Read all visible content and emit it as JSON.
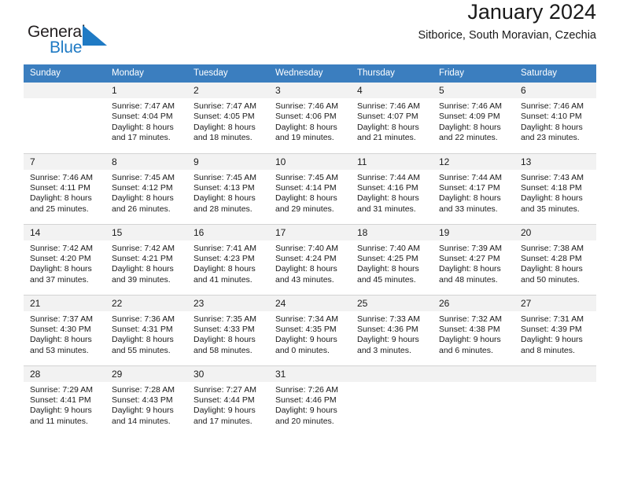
{
  "brand": {
    "name_part1": "General",
    "name_part2": "Blue",
    "flag_icon": "flag-triangle-icon",
    "flag_color": "#1f7ac4"
  },
  "header": {
    "title": "January 2024",
    "subtitle": "Sitborice, South Moravian, Czechia"
  },
  "theme": {
    "header_bg": "#3b7ebf",
    "header_text": "#ffffff",
    "daynum_bg": "#f2f2f2",
    "grid_line": "#d3d3d3",
    "body_text": "#1a1a1a"
  },
  "weekdays": [
    "Sunday",
    "Monday",
    "Tuesday",
    "Wednesday",
    "Thursday",
    "Friday",
    "Saturday"
  ],
  "labels": {
    "sunrise_prefix": "Sunrise:",
    "sunset_prefix": "Sunset:",
    "daylight_prefix": "Daylight:"
  },
  "weeks": [
    [
      {
        "day": "",
        "blank": true,
        "line1": "",
        "line2": "",
        "line3": "",
        "line4": ""
      },
      {
        "day": "1",
        "line1": "Sunrise: 7:47 AM",
        "line2": "Sunset: 4:04 PM",
        "line3": "Daylight: 8 hours",
        "line4": "and 17 minutes."
      },
      {
        "day": "2",
        "line1": "Sunrise: 7:47 AM",
        "line2": "Sunset: 4:05 PM",
        "line3": "Daylight: 8 hours",
        "line4": "and 18 minutes."
      },
      {
        "day": "3",
        "line1": "Sunrise: 7:46 AM",
        "line2": "Sunset: 4:06 PM",
        "line3": "Daylight: 8 hours",
        "line4": "and 19 minutes."
      },
      {
        "day": "4",
        "line1": "Sunrise: 7:46 AM",
        "line2": "Sunset: 4:07 PM",
        "line3": "Daylight: 8 hours",
        "line4": "and 21 minutes."
      },
      {
        "day": "5",
        "line1": "Sunrise: 7:46 AM",
        "line2": "Sunset: 4:09 PM",
        "line3": "Daylight: 8 hours",
        "line4": "and 22 minutes."
      },
      {
        "day": "6",
        "line1": "Sunrise: 7:46 AM",
        "line2": "Sunset: 4:10 PM",
        "line3": "Daylight: 8 hours",
        "line4": "and 23 minutes."
      }
    ],
    [
      {
        "day": "7",
        "line1": "Sunrise: 7:46 AM",
        "line2": "Sunset: 4:11 PM",
        "line3": "Daylight: 8 hours",
        "line4": "and 25 minutes."
      },
      {
        "day": "8",
        "line1": "Sunrise: 7:45 AM",
        "line2": "Sunset: 4:12 PM",
        "line3": "Daylight: 8 hours",
        "line4": "and 26 minutes."
      },
      {
        "day": "9",
        "line1": "Sunrise: 7:45 AM",
        "line2": "Sunset: 4:13 PM",
        "line3": "Daylight: 8 hours",
        "line4": "and 28 minutes."
      },
      {
        "day": "10",
        "line1": "Sunrise: 7:45 AM",
        "line2": "Sunset: 4:14 PM",
        "line3": "Daylight: 8 hours",
        "line4": "and 29 minutes."
      },
      {
        "day": "11",
        "line1": "Sunrise: 7:44 AM",
        "line2": "Sunset: 4:16 PM",
        "line3": "Daylight: 8 hours",
        "line4": "and 31 minutes."
      },
      {
        "day": "12",
        "line1": "Sunrise: 7:44 AM",
        "line2": "Sunset: 4:17 PM",
        "line3": "Daylight: 8 hours",
        "line4": "and 33 minutes."
      },
      {
        "day": "13",
        "line1": "Sunrise: 7:43 AM",
        "line2": "Sunset: 4:18 PM",
        "line3": "Daylight: 8 hours",
        "line4": "and 35 minutes."
      }
    ],
    [
      {
        "day": "14",
        "line1": "Sunrise: 7:42 AM",
        "line2": "Sunset: 4:20 PM",
        "line3": "Daylight: 8 hours",
        "line4": "and 37 minutes."
      },
      {
        "day": "15",
        "line1": "Sunrise: 7:42 AM",
        "line2": "Sunset: 4:21 PM",
        "line3": "Daylight: 8 hours",
        "line4": "and 39 minutes."
      },
      {
        "day": "16",
        "line1": "Sunrise: 7:41 AM",
        "line2": "Sunset: 4:23 PM",
        "line3": "Daylight: 8 hours",
        "line4": "and 41 minutes."
      },
      {
        "day": "17",
        "line1": "Sunrise: 7:40 AM",
        "line2": "Sunset: 4:24 PM",
        "line3": "Daylight: 8 hours",
        "line4": "and 43 minutes."
      },
      {
        "day": "18",
        "line1": "Sunrise: 7:40 AM",
        "line2": "Sunset: 4:25 PM",
        "line3": "Daylight: 8 hours",
        "line4": "and 45 minutes."
      },
      {
        "day": "19",
        "line1": "Sunrise: 7:39 AM",
        "line2": "Sunset: 4:27 PM",
        "line3": "Daylight: 8 hours",
        "line4": "and 48 minutes."
      },
      {
        "day": "20",
        "line1": "Sunrise: 7:38 AM",
        "line2": "Sunset: 4:28 PM",
        "line3": "Daylight: 8 hours",
        "line4": "and 50 minutes."
      }
    ],
    [
      {
        "day": "21",
        "line1": "Sunrise: 7:37 AM",
        "line2": "Sunset: 4:30 PM",
        "line3": "Daylight: 8 hours",
        "line4": "and 53 minutes."
      },
      {
        "day": "22",
        "line1": "Sunrise: 7:36 AM",
        "line2": "Sunset: 4:31 PM",
        "line3": "Daylight: 8 hours",
        "line4": "and 55 minutes."
      },
      {
        "day": "23",
        "line1": "Sunrise: 7:35 AM",
        "line2": "Sunset: 4:33 PM",
        "line3": "Daylight: 8 hours",
        "line4": "and 58 minutes."
      },
      {
        "day": "24",
        "line1": "Sunrise: 7:34 AM",
        "line2": "Sunset: 4:35 PM",
        "line3": "Daylight: 9 hours",
        "line4": "and 0 minutes."
      },
      {
        "day": "25",
        "line1": "Sunrise: 7:33 AM",
        "line2": "Sunset: 4:36 PM",
        "line3": "Daylight: 9 hours",
        "line4": "and 3 minutes."
      },
      {
        "day": "26",
        "line1": "Sunrise: 7:32 AM",
        "line2": "Sunset: 4:38 PM",
        "line3": "Daylight: 9 hours",
        "line4": "and 6 minutes."
      },
      {
        "day": "27",
        "line1": "Sunrise: 7:31 AM",
        "line2": "Sunset: 4:39 PM",
        "line3": "Daylight: 9 hours",
        "line4": "and 8 minutes."
      }
    ],
    [
      {
        "day": "28",
        "line1": "Sunrise: 7:29 AM",
        "line2": "Sunset: 4:41 PM",
        "line3": "Daylight: 9 hours",
        "line4": "and 11 minutes."
      },
      {
        "day": "29",
        "line1": "Sunrise: 7:28 AM",
        "line2": "Sunset: 4:43 PM",
        "line3": "Daylight: 9 hours",
        "line4": "and 14 minutes."
      },
      {
        "day": "30",
        "line1": "Sunrise: 7:27 AM",
        "line2": "Sunset: 4:44 PM",
        "line3": "Daylight: 9 hours",
        "line4": "and 17 minutes."
      },
      {
        "day": "31",
        "line1": "Sunrise: 7:26 AM",
        "line2": "Sunset: 4:46 PM",
        "line3": "Daylight: 9 hours",
        "line4": "and 20 minutes."
      },
      {
        "day": "",
        "blank": true,
        "empty_tail": true,
        "line1": "",
        "line2": "",
        "line3": "",
        "line4": ""
      },
      {
        "day": "",
        "blank": true,
        "empty_tail": true,
        "line1": "",
        "line2": "",
        "line3": "",
        "line4": ""
      },
      {
        "day": "",
        "blank": true,
        "empty_tail": true,
        "line1": "",
        "line2": "",
        "line3": "",
        "line4": ""
      }
    ]
  ]
}
